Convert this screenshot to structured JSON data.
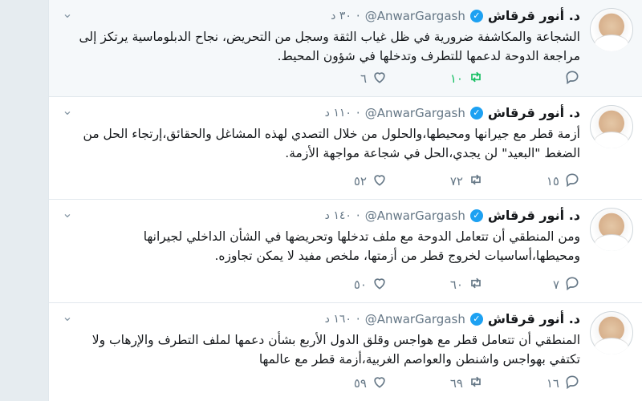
{
  "tweets": [
    {
      "name": "د. أنور قرقاش",
      "handle": "@AnwarGargash",
      "time": "٣٠ د",
      "text": "الشجاعة والمكاشفة ضرورية في ظل غياب الثقة وسجل من التحريض، نجاح الدبلوماسية يرتكز إلى مراجعة الدوحة لدعمها للتطرف وتدخلها في شؤون المحيط.",
      "replies": "",
      "retweets": "١٠",
      "likes": "٦",
      "retweeted": true,
      "highlighted": true
    },
    {
      "name": "د. أنور قرقاش",
      "handle": "@AnwarGargash",
      "time": "١١٠ د",
      "text": "أزمة قطر مع جيرانها ومحيطها،والحلول من خلال التصدي لهذه المشاغل والحقائق،إرتجاء الحل من الضغط \"البعيد\" لن يجدي،الحل في شجاعة مواجهة الأزمة.",
      "replies": "١٥",
      "retweets": "٧٢",
      "likes": "٥٢",
      "retweeted": false,
      "highlighted": false
    },
    {
      "name": "د. أنور قرقاش",
      "handle": "@AnwarGargash",
      "time": "١٤٠ د",
      "text": "ومن المنطقي أن تتعامل الدوحة مع ملف تدخلها وتحريضها في الشأن الداخلي لجيرانها ومحيطها،أساسيات لخروج قطر من أزمتها، ملخص مفيد لا يمكن تجاوزه.",
      "replies": "٧",
      "retweets": "٦٠",
      "likes": "٥٠",
      "retweeted": false,
      "highlighted": false
    },
    {
      "name": "د. أنور قرقاش",
      "handle": "@AnwarGargash",
      "time": "١٦٠ د",
      "text": "المنطقي أن تتعامل قطر مع هواجس وقلق الدول الأربع بشأن دعمها لملف التطرف والإرهاب ولا تكتفي بهواجس واشنطن والعواصم الغربية،أزمة قطر مع عالمها",
      "replies": "١٦",
      "retweets": "٦٩",
      "likes": "٥٩",
      "retweeted": false,
      "highlighted": false
    }
  ],
  "icons": {
    "verified": "verified-badge-icon",
    "caret": "chevron-down-icon",
    "reply": "reply-icon",
    "retweet": "retweet-icon",
    "like": "heart-icon"
  },
  "colors": {
    "accent": "#1da1f2",
    "retweet_active": "#17bf63",
    "muted": "#657786"
  }
}
